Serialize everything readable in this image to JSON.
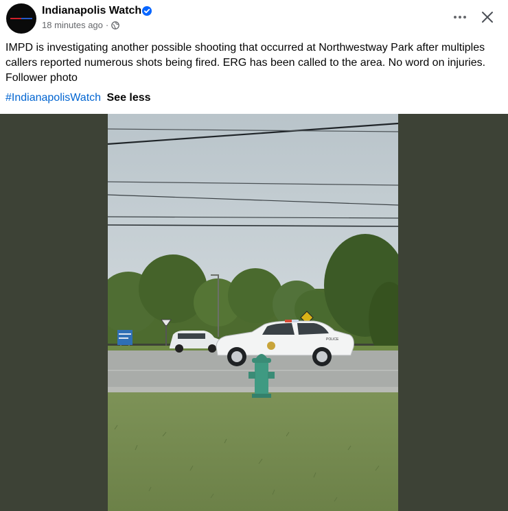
{
  "post": {
    "author": "Indianapolis Watch",
    "timestamp": "18 minutes ago",
    "separator": "·",
    "audience_icon": "globe-icon",
    "verified_icon": "verified-badge-icon",
    "body": "IMPD is investigating another possible shooting that occurred at Northwestway Park after multiples callers reported numerous shots being fired. ERG has been called to the area. No word on injuries. Follower photo",
    "hashtag": "#IndianapolisWatch",
    "see_less": "See less"
  },
  "actions": {
    "more_icon": "more-options-icon",
    "close_icon": "close-icon"
  },
  "colors": {
    "verified": "#0866ff",
    "link": "#0064d1",
    "secondary_text": "#65676b",
    "media_background": "#3d4236"
  },
  "photo": {
    "car_label": "POLICE"
  }
}
